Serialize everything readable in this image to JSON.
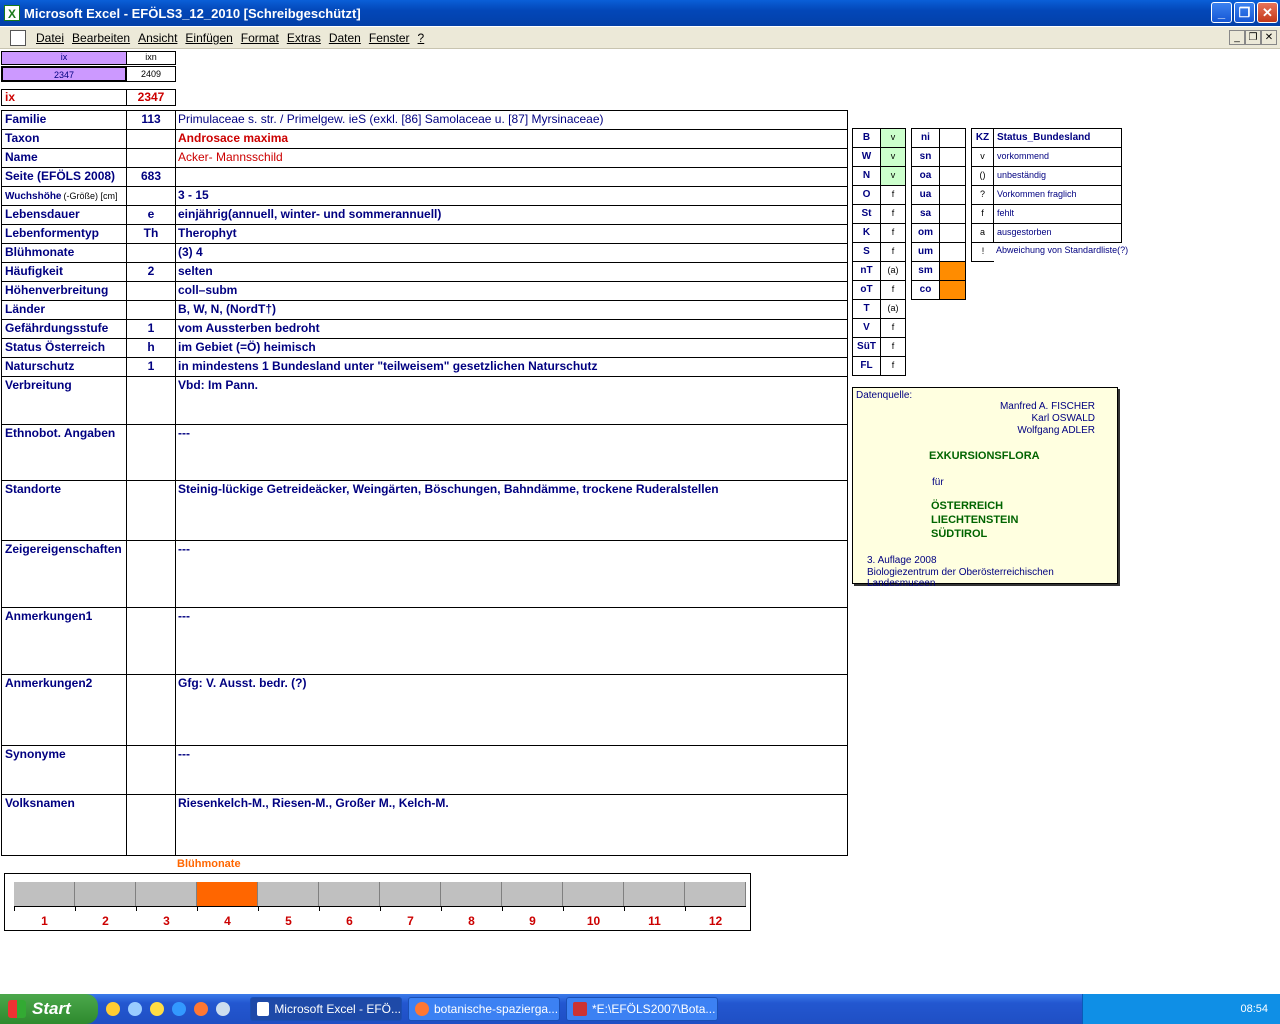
{
  "window": {
    "title": "Microsoft Excel - EFÖLS3_12_2010  [Schreibgeschützt]"
  },
  "menu": [
    "Datei",
    "Bearbeiten",
    "Ansicht",
    "Einfügen",
    "Format",
    "Extras",
    "Daten",
    "Fenster",
    "?"
  ],
  "top": {
    "ix_hdr": "ix",
    "ixn_hdr": "ixn",
    "ix_val": "2347",
    "ixn_val": "2409",
    "ix_label": "ix",
    "ix_red": "2347"
  },
  "fields": [
    {
      "label": "Familie",
      "code": "113",
      "value": "Primulaceae s. str.  /  Primelgew. ieS (exkl. [86] Samolaceae u. [87] Myrsinaceae)"
    },
    {
      "label": "Taxon",
      "code": "",
      "value": "Androsace maxima"
    },
    {
      "label": "Name",
      "code": "",
      "value": "Acker- Mannsschild"
    },
    {
      "label": "Seite (EFÖLS 2008)",
      "code": "683",
      "value": ""
    },
    {
      "label": "Wuchshöhe",
      "label_small": "(-Größe) [cm]",
      "code": "",
      "value": " 3 - 15"
    },
    {
      "label": "Lebensdauer",
      "code": "e",
      "value": "einjährig(annuell, winter- und sommerannuell)"
    },
    {
      "label": "Lebenformentyp",
      "code": "Th",
      "value": "Therophyt"
    },
    {
      "label": "Blühmonate",
      "code": "",
      "value": "(3) 4"
    },
    {
      "label": "Häufigkeit",
      "code": "2",
      "value": "selten"
    },
    {
      "label": "Höhenverbreitung",
      "code": "",
      "value": "coll–subm"
    },
    {
      "label": "Länder",
      "code": "",
      "value": "B, W, N, (NordT†)"
    },
    {
      "label": "Gefährdungsstufe",
      "code": "1",
      "value": "vom Aussterben bedroht"
    },
    {
      "label": "Status Österreich",
      "code": "h",
      "value": "im Gebiet (=Ö) heimisch"
    },
    {
      "label": "Naturschutz",
      "code": "1",
      "value": "in mindestens 1 Bundesland unter \"teilweisem\" gesetzlichen Naturschutz"
    },
    {
      "label": "Verbreitung",
      "code": "",
      "value": "Vbd:  Im Pann."
    },
    {
      "label": "Ethnobot. Angaben",
      "code": "",
      "value": "---"
    },
    {
      "label": "Standorte",
      "code": "",
      "value": "Steinig-lückige Getreideäcker, Weingärten, Böschungen, Bahndämme, trockene Ruderalstellen"
    },
    {
      "label": "Zeigereigenschaften",
      "code": "",
      "value": "---"
    },
    {
      "label": "Anmerkungen1",
      "code": "",
      "value": "---"
    },
    {
      "label": "Anmerkungen2",
      "code": "",
      "value": "Gfg: V. Ausst. bedr. (?)"
    },
    {
      "label": "Synonyme",
      "code": "",
      "value": "---"
    },
    {
      "label": "Volksnamen",
      "code": "",
      "value": "Riesenkelch-M., Riesen-M., Großer M., Kelch-M."
    }
  ],
  "states1": [
    [
      "B",
      "v"
    ],
    [
      "W",
      "v"
    ],
    [
      "N",
      "v"
    ],
    [
      "O",
      "f"
    ],
    [
      "St",
      "f"
    ],
    [
      "K",
      "f"
    ],
    [
      "S",
      "f"
    ],
    [
      "nT",
      "(a)"
    ],
    [
      "oT",
      "f"
    ],
    [
      "T",
      "(a)"
    ],
    [
      "V",
      "f"
    ],
    [
      "SüT",
      "f"
    ],
    [
      "FL",
      "f"
    ]
  ],
  "states2": [
    [
      "ni",
      ""
    ],
    [
      "sn",
      ""
    ],
    [
      "oa",
      ""
    ],
    [
      "ua",
      ""
    ],
    [
      "sa",
      ""
    ],
    [
      "om",
      ""
    ],
    [
      "um",
      ""
    ],
    [
      "sm",
      ""
    ],
    [
      "co",
      ""
    ]
  ],
  "legend": {
    "kz": "KZ",
    "title": "Status_Bundesland",
    "rows": [
      [
        "v",
        "vorkommend"
      ],
      [
        "()",
        "unbeständig"
      ],
      [
        "?",
        "Vorkommen fraglich"
      ],
      [
        "f",
        "fehlt"
      ],
      [
        "a",
        "ausgestorben"
      ],
      [
        "!",
        "Abweichung von Standardliste(?)"
      ]
    ]
  },
  "source": {
    "heading": "Datenquelle:",
    "authors": [
      "Manfred A. FISCHER",
      "Karl OSWALD",
      "Wolfgang ADLER"
    ],
    "book": "EXKURSIONSFLORA",
    "fuer": "für",
    "regions": [
      "ÖSTERREICH",
      "LIECHTENSTEIN",
      "SÜDTIROL"
    ],
    "edition": "3. Auflage 2008",
    "publisher": "Biologiezentrum der Oberösterreichischen Landesmuseen"
  },
  "chart_data": {
    "type": "bar",
    "title": "Blühmonate",
    "categories": [
      "1",
      "2",
      "3",
      "4",
      "5",
      "6",
      "7",
      "8",
      "9",
      "10",
      "11",
      "12"
    ],
    "values": [
      0,
      0,
      0,
      1,
      0,
      0,
      0,
      0,
      0,
      0,
      0,
      0
    ],
    "colors": {
      "flowering": "#ff6600",
      "not_flowering": "#c0c0c0"
    }
  },
  "colors": {
    "accent_green": "#ccffcc",
    "orange": "#ff8c00",
    "purple": "#cc99ff",
    "title_blue": "#0a5fd8"
  },
  "taskbar": {
    "start": "Start",
    "tasks": [
      "Microsoft Excel - EFÖ...",
      "botanische-spazierga...",
      "*E:\\EFÖLS2007\\Bota..."
    ],
    "clock": "08:54"
  }
}
